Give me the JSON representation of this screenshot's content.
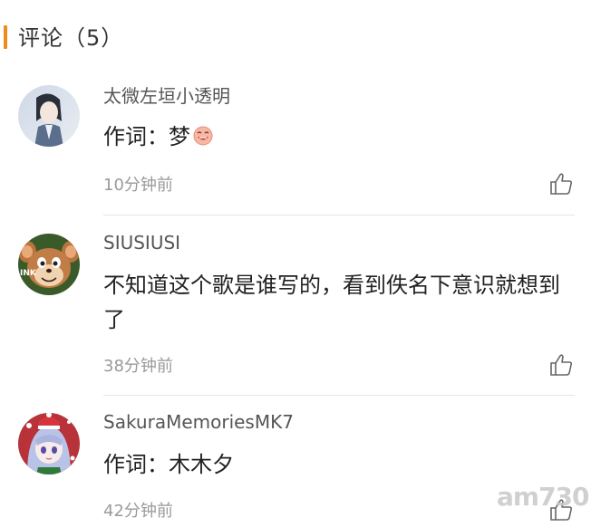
{
  "header": {
    "title": "评论（5）"
  },
  "comments": [
    {
      "username": "太微左垣小透明",
      "text": "作词：梦",
      "time": "10分钟前",
      "avatar_icon": "anime-character-avatar",
      "emoji": "laughing-face-emoji"
    },
    {
      "username": "SIUSIUSI",
      "text": "不知道这个歌是谁写的，看到佚名下意识就想到了",
      "time": "38分钟前",
      "avatar_icon": "cartoon-mouse-avatar",
      "avatar_badge": "INK"
    },
    {
      "username": "SakuraMemoriesMK7",
      "text": "作词：木木夕",
      "time": "42分钟前",
      "avatar_icon": "anime-girl-avatar"
    }
  ],
  "watermark": {
    "text": "am730"
  },
  "colors": {
    "accent": "#f08a1c",
    "time": "#9a9a9a",
    "divider": "#e6e6e6"
  }
}
